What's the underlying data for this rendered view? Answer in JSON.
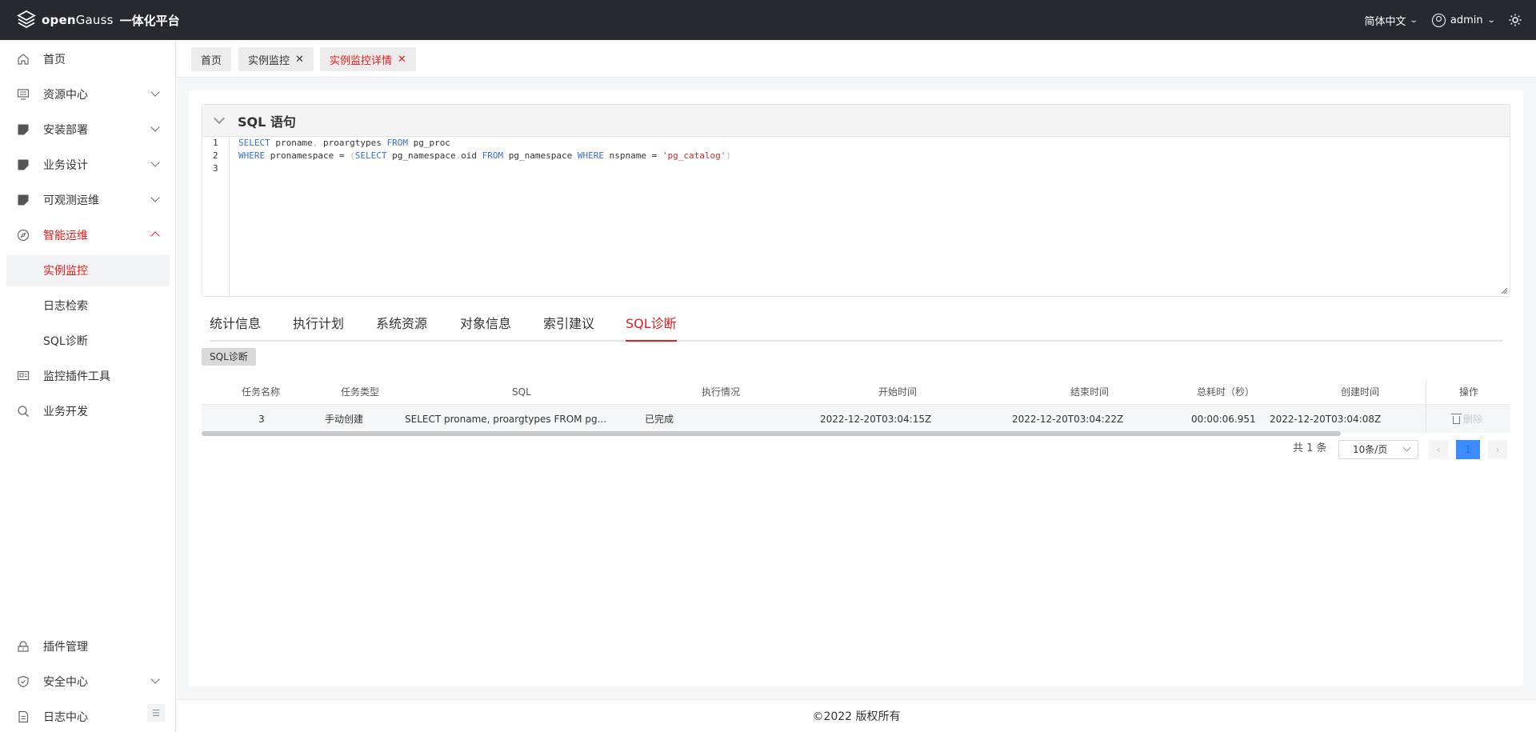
{
  "header": {
    "brand_open": "open",
    "brand_gauss": "Gauss",
    "platform": "一体化平台",
    "language": "简体中文",
    "user": "admin"
  },
  "sidebar": {
    "items": [
      {
        "label": "首页",
        "icon": "home-icon"
      },
      {
        "label": "资源中心",
        "icon": "server-icon"
      },
      {
        "label": "安装部署",
        "icon": "install-icon"
      },
      {
        "label": "业务设计",
        "icon": "design-icon"
      },
      {
        "label": "可观测运维",
        "icon": "monitor-icon"
      },
      {
        "label": "智能运维",
        "icon": "compass-icon"
      },
      {
        "label": "监控插件工具",
        "icon": "plugin-tool-icon"
      },
      {
        "label": "业务开发",
        "icon": "search-icon"
      },
      {
        "label": "插件管理",
        "icon": "plugin-manage-icon"
      },
      {
        "label": "安全中心",
        "icon": "shield-icon"
      },
      {
        "label": "日志中心",
        "icon": "log-icon"
      }
    ],
    "subitems": [
      "实例监控",
      "日志检索",
      "SQL诊断"
    ]
  },
  "tags": [
    {
      "label": "首页"
    },
    {
      "label": "实例监控"
    },
    {
      "label": "实例监控详情"
    }
  ],
  "sql_card": {
    "title": "SQL 语句",
    "line_numbers": [
      "1",
      "2",
      "3"
    ]
  },
  "analysis_tabs": [
    "统计信息",
    "执行计划",
    "系统资源",
    "对象信息",
    "索引建议",
    "SQL诊断"
  ],
  "subtag": "SQL诊断",
  "table": {
    "columns": [
      "任务名称",
      "任务类型",
      "SQL",
      "执行情况",
      "开始时间",
      "结束时间",
      "总耗时（秒）",
      "创建时间",
      "操作"
    ],
    "rows": [
      {
        "name": "3",
        "type": "手动创建",
        "sql": "SELECT proname, proargtypes FROM pg...",
        "status": "已完成",
        "start": "2022-12-20T03:04:15Z",
        "end": "2022-12-20T03:04:22Z",
        "duration": "00:00:06.951",
        "created": "2022-12-20T03:04:08Z",
        "action": "删除"
      }
    ]
  },
  "pager": {
    "total": "共 1 条",
    "page_size": "10条/页",
    "current": "1"
  },
  "footer": "©2022 版权所有",
  "colors": {
    "accent": "#e41d1d",
    "topbar": "#27292e",
    "keyword": "#3a6fd0",
    "string": "#d12a2a"
  }
}
